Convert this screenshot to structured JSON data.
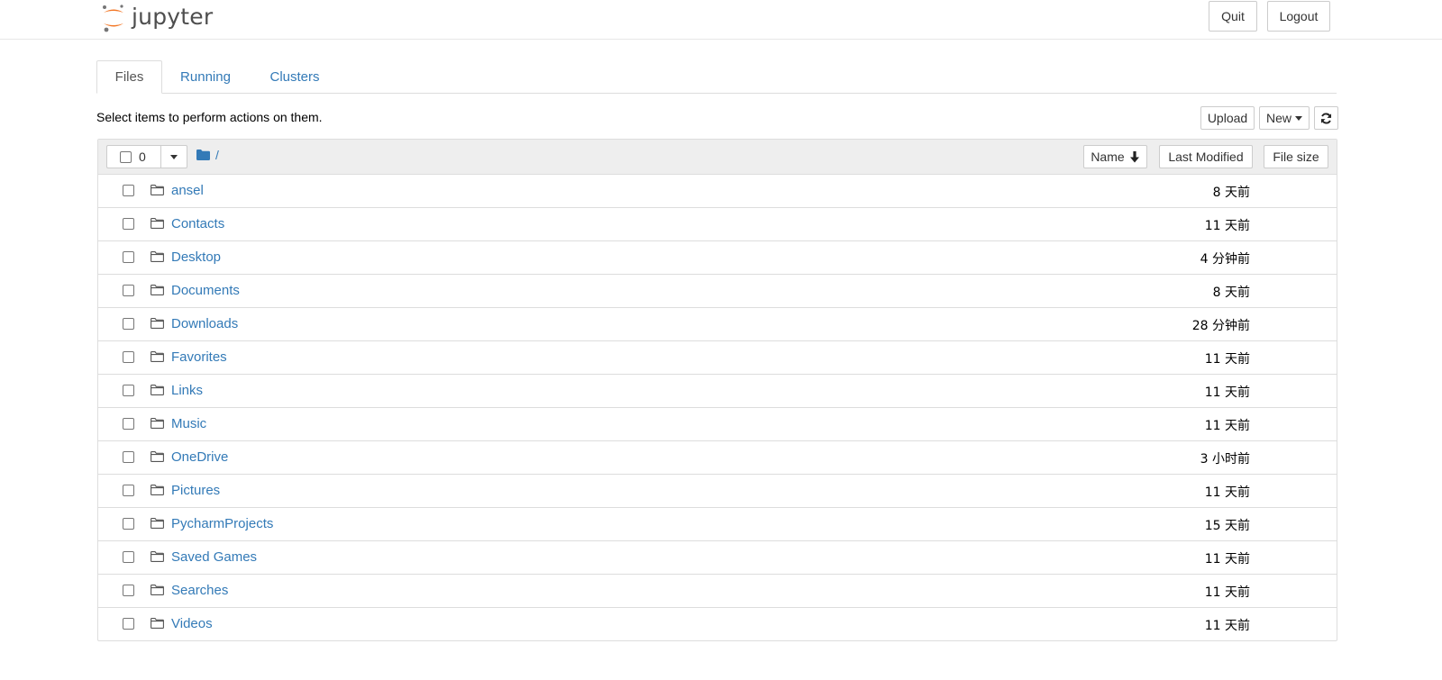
{
  "header": {
    "logo_text": "jupyter",
    "quit_label": "Quit",
    "logout_label": "Logout",
    "logo_colors": {
      "orange": "#f37726",
      "gray": "#767677"
    }
  },
  "tabs": [
    {
      "label": "Files",
      "active": true
    },
    {
      "label": "Running",
      "active": false
    },
    {
      "label": "Clusters",
      "active": false
    }
  ],
  "toolbar": {
    "message": "Select items to perform actions on them.",
    "upload_label": "Upload",
    "new_label": "New",
    "refresh_icon": "refresh-icon"
  },
  "list_header": {
    "selected_count": "0",
    "breadcrumb": "/",
    "sort_name_label": "Name",
    "sort_name_icon": "arrow-down-icon",
    "last_modified_label": "Last Modified",
    "file_size_label": "File size"
  },
  "items": [
    {
      "name": "ansel",
      "modified": "8 天前"
    },
    {
      "name": "Contacts",
      "modified": "11 天前"
    },
    {
      "name": "Desktop",
      "modified": "4 分钟前"
    },
    {
      "name": "Documents",
      "modified": "8 天前"
    },
    {
      "name": "Downloads",
      "modified": "28 分钟前"
    },
    {
      "name": "Favorites",
      "modified": "11 天前"
    },
    {
      "name": "Links",
      "modified": "11 天前"
    },
    {
      "name": "Music",
      "modified": "11 天前"
    },
    {
      "name": "OneDrive",
      "modified": "3 小时前"
    },
    {
      "name": "Pictures",
      "modified": "11 天前"
    },
    {
      "name": "PycharmProjects",
      "modified": "15 天前"
    },
    {
      "name": "Saved Games",
      "modified": "11 天前"
    },
    {
      "name": "Searches",
      "modified": "11 天前"
    },
    {
      "name": "Videos",
      "modified": "11 天前"
    }
  ],
  "colors": {
    "link": "#337ab7",
    "header_bg": "#eeeeee",
    "border": "#dddddd"
  }
}
